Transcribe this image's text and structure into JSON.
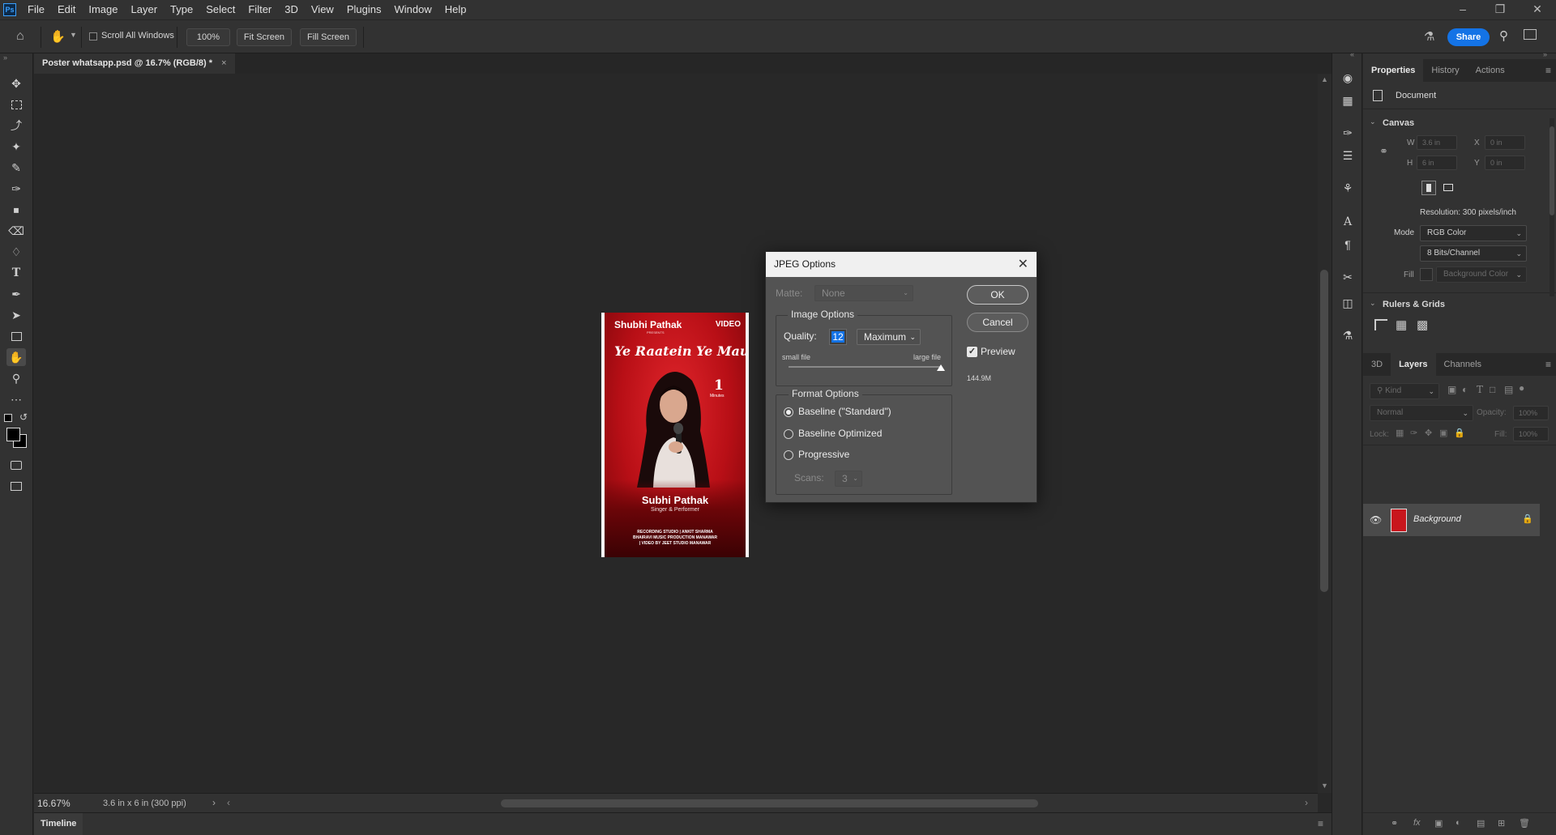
{
  "menubar": {
    "app_icon": "Ps",
    "items": [
      "File",
      "Edit",
      "Image",
      "Layer",
      "Type",
      "Select",
      "Filter",
      "3D",
      "View",
      "Plugins",
      "Window",
      "Help"
    ]
  },
  "optionsbar": {
    "scroll_all_windows": "Scroll All Windows",
    "zoom_btn": "100%",
    "fit_screen": "Fit Screen",
    "fill_screen": "Fill Screen",
    "share": "Share"
  },
  "document": {
    "tab_title": "Poster whatsapp.psd @ 16.7% (RGB/8) *",
    "zoom": "16.67%",
    "doc_info": "3.6 in x 6 in (300 ppi)"
  },
  "poster": {
    "brand": "Shubhi Pathak",
    "presents": "PRESENTS",
    "video": "VIDEO",
    "title": "Ye Raatein Ye Mausam",
    "number": "1",
    "number_sub": "Minutes",
    "name": "Subhi Pathak",
    "role": "Singer & Performer",
    "credits": [
      "RECORDING STUDIO | ANKIT SHARMA",
      "BHAIRAVI MUSIC PRODUCTION  MANAWAR",
      "| VIDEO BY JEET STUDIO MANAWAR"
    ]
  },
  "dialog": {
    "title": "JPEG Options",
    "matte_label": "Matte:",
    "matte_value": "None",
    "image_options": "Image Options",
    "quality_label": "Quality:",
    "quality_value": "12",
    "quality_preset": "Maximum",
    "small_file": "small file",
    "large_file": "large file",
    "quality_slider_fraction": 1.0,
    "format_options": "Format Options",
    "formats": [
      "Baseline (\"Standard\")",
      "Baseline Optimized",
      "Progressive"
    ],
    "selected_format": 0,
    "scans_label": "Scans:",
    "scans_value": "3",
    "ok": "OK",
    "cancel": "Cancel",
    "preview": "Preview",
    "preview_checked": true,
    "file_size": "144.9M"
  },
  "properties": {
    "tabs": [
      "Properties",
      "History",
      "Actions"
    ],
    "document_label": "Document",
    "canvas_section": "Canvas",
    "w_label": "W",
    "w_value": "3.6 in",
    "h_label": "H",
    "h_value": "6 in",
    "x_label": "X",
    "x_value": "0 in",
    "y_label": "Y",
    "y_value": "0 in",
    "resolution": "Resolution: 300 pixels/inch",
    "mode_label": "Mode",
    "mode_value": "RGB Color",
    "bits_value": "8 Bits/Channel",
    "fill_label": "Fill",
    "fill_value": "Background Color",
    "rulers_section": "Rulers & Grids"
  },
  "layers": {
    "tabs": [
      "3D",
      "Layers",
      "Channels"
    ],
    "kind_placeholder": "Kind",
    "blend_mode": "Normal",
    "opacity_label": "Opacity:",
    "opacity_value": "100%",
    "lock_label": "Lock:",
    "fill_label": "Fill:",
    "fill_value": "100%",
    "items": [
      {
        "name": "Background",
        "visible": true,
        "locked": true
      }
    ]
  },
  "timeline": {
    "label": "Timeline"
  },
  "colors": {
    "accent": "#1473e6",
    "poster_red": "#c8161d"
  }
}
